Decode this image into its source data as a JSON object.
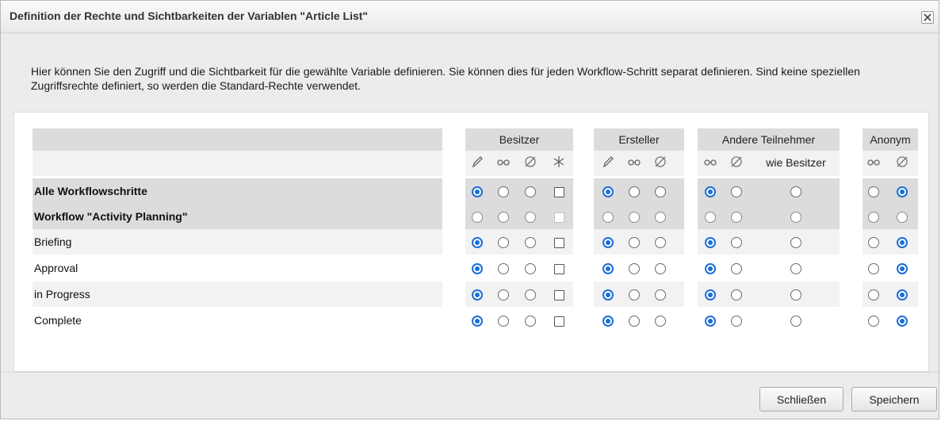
{
  "dialog": {
    "title": "Definition der Rechte und Sichtbarkeiten der Variablen \"Article List\"",
    "close_icon": "close-x-icon",
    "intro": "Hier können Sie den Zugriff und die Sichtbarkeit für die gewählte Variable definieren. Sie können dies für jeden Workflow-Schritt separat definieren. Sind keine speziellen Zugriffsrechte definiert, so werden die Standard-Rechte verwendet."
  },
  "groups": [
    {
      "label": "Besitzer",
      "icons": [
        "edit-pencil-icon",
        "glasses-view-icon",
        "invisible-eye-icon",
        "asterisk-icon"
      ]
    },
    {
      "label": "Ersteller",
      "icons": [
        "edit-pencil-icon",
        "glasses-view-icon",
        "invisible-eye-icon"
      ]
    },
    {
      "label": "Andere Teilnehmer",
      "icons": [
        "glasses-view-icon",
        "invisible-eye-icon"
      ],
      "extra_label": "wie Besitzer"
    },
    {
      "label": "Anonym",
      "icons": [
        "glasses-view-icon",
        "invisible-eye-icon"
      ]
    }
  ],
  "rows": [
    {
      "label": "Alle Workflowschritte",
      "bold": true,
      "besitzer": "edit",
      "besitzer_star": false,
      "ersteller": "edit",
      "andere": "view",
      "anonym": "hidden",
      "disabled_check": false
    },
    {
      "label": "Workflow \"Activity Planning\"",
      "bold": true,
      "besitzer": "",
      "besitzer_star": false,
      "ersteller": "",
      "andere": "",
      "anonym": "",
      "disabled_check": true
    },
    {
      "label": "Briefing",
      "bold": false,
      "besitzer": "edit",
      "besitzer_star": false,
      "ersteller": "edit",
      "andere": "view",
      "anonym": "hidden",
      "disabled_check": false
    },
    {
      "label": "Approval",
      "bold": false,
      "besitzer": "edit",
      "besitzer_star": false,
      "ersteller": "edit",
      "andere": "view",
      "anonym": "hidden",
      "disabled_check": false
    },
    {
      "label": "in Progress",
      "bold": false,
      "besitzer": "edit",
      "besitzer_star": false,
      "ersteller": "edit",
      "andere": "view",
      "anonym": "hidden",
      "disabled_check": false
    },
    {
      "label": "Complete",
      "bold": false,
      "besitzer": "edit",
      "besitzer_star": false,
      "ersteller": "edit",
      "andere": "view",
      "anonym": "hidden",
      "disabled_check": false
    }
  ],
  "buttons": {
    "close": "Schließen",
    "save": "Speichern"
  },
  "colors": {
    "accent": "#1a6ed8",
    "header_bar": "#dcdcdc",
    "row_shade": "#f2f2f2",
    "bold_row_shade": "#dcdcdc"
  }
}
